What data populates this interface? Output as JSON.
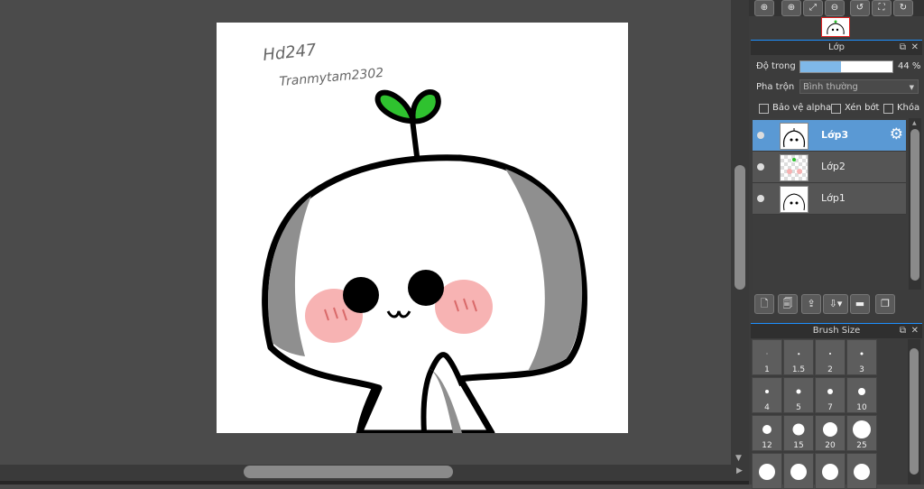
{
  "window": {
    "nav_buttons": [
      "⊕",
      "⊕",
      "⤢",
      "⊖",
      "↺",
      "⛶",
      "↻"
    ]
  },
  "canvas": {
    "signature_line1": "Hd247",
    "signature_line2": "Tranmytam2302"
  },
  "layer_panel": {
    "title": "Lớp",
    "opacity_label": "Độ trong",
    "opacity_value": "44 %",
    "opacity_fraction": 0.44,
    "blend_label": "Pha trộn",
    "blend_value": "Bình thường",
    "options": {
      "protect_alpha": "Bảo vệ alpha",
      "clipping": "Xén bớt",
      "lock": "Khóa"
    },
    "layers": [
      {
        "name": "Lớp3",
        "active": true
      },
      {
        "name": "Lớp2",
        "active": false
      },
      {
        "name": "Lớp1",
        "active": false
      }
    ],
    "tools": [
      "🗋",
      "🗐",
      "⇪",
      "⇩▾",
      "▬",
      "❐"
    ]
  },
  "brush_panel": {
    "title": "Brush Size",
    "sizes": [
      "1",
      "1.5",
      "2",
      "3",
      "4",
      "5",
      "7",
      "10",
      "12",
      "15",
      "20",
      "25",
      "",
      "",
      "",
      ""
    ]
  },
  "colors": {
    "accent": "#1e90ff",
    "active_layer": "#5a99d4",
    "sprout_green": "#2fc22f"
  }
}
